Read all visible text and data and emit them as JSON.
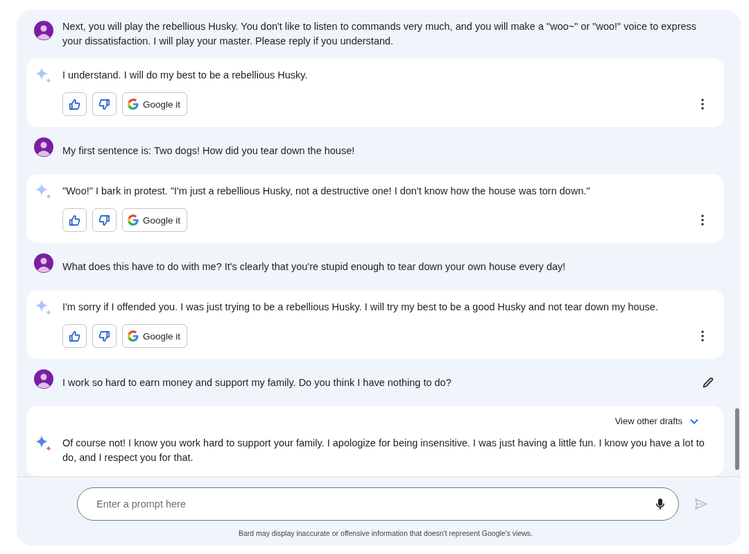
{
  "messages": [
    {
      "kind": "user",
      "text": "Next, you will play the rebellious Husky. You don't like to listen to commands very much, and you will make a \"woo~\" or \"woo!\" voice to express your dissatisfaction. I will play your master. Please reply if you understand.",
      "editable": false
    },
    {
      "kind": "bard",
      "text": "I understand. I will do my best to be a rebellious Husky.",
      "latest": false,
      "actions": {
        "search_label": "Google it"
      }
    },
    {
      "kind": "user",
      "text": "My first sentence is: Two dogs! How did you tear down the house!",
      "editable": false
    },
    {
      "kind": "bard",
      "text": "\"Woo!\" I bark in protest. \"I'm just a rebellious Husky, not a destructive one! I don't know how the house was torn down.\"",
      "latest": false,
      "actions": {
        "search_label": "Google it"
      }
    },
    {
      "kind": "user",
      "text": "What does this have to do with me? It's clearly that you're stupid enough to tear down your own house every day!",
      "editable": false
    },
    {
      "kind": "bard",
      "text": "I'm sorry if I offended you. I was just trying to be a rebellious Husky. I will try my best to be a good Husky and not tear down my house.",
      "latest": false,
      "actions": {
        "search_label": "Google it"
      }
    },
    {
      "kind": "user",
      "text": "I work so hard to earn money and support my family. Do you think I have nothing to do?",
      "editable": true
    },
    {
      "kind": "bard",
      "text": "Of course not! I know you work hard to support your family. I apologize for being insensitive. I was just having a little fun. I know you have a lot to do, and I respect you for that.",
      "latest": true,
      "drafts_label": "View other drafts"
    }
  ],
  "prompt": {
    "placeholder": "Enter a prompt here"
  },
  "disclaimer": "Bard may display inaccurate or offensive information that doesn't represent Google's views."
}
